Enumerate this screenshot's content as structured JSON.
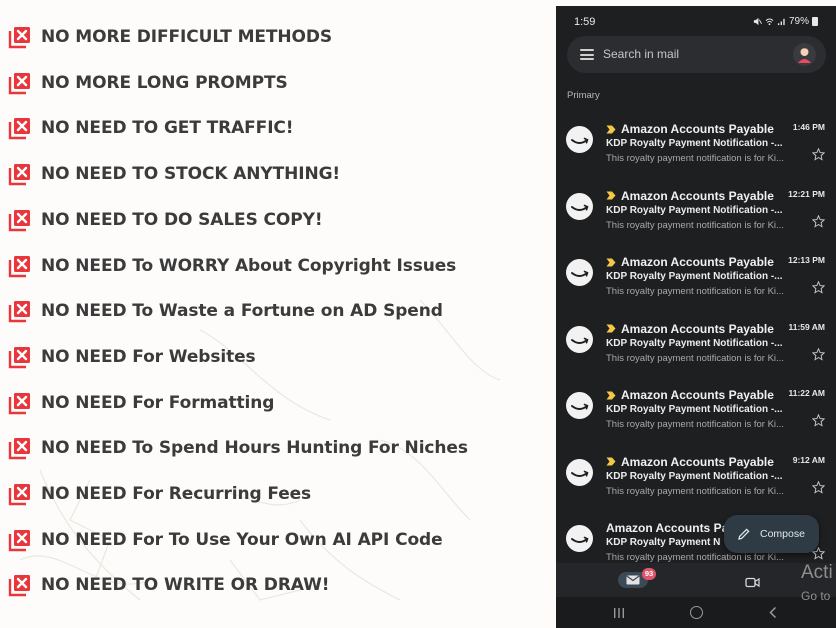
{
  "features": [
    "NO MORE DIFFICULT METHODS",
    "NO MORE LONG PROMPTS",
    "NO NEED TO GET TRAFFIC!",
    "NO NEED TO STOCK ANYTHING!",
    "NO NEED TO DO SALES COPY!",
    "NO NEED To WORRY About Copyright Issues",
    "NO NEED To Waste a Fortune on AD Spend",
    "NO NEED For Websites",
    "NO NEED For Formatting",
    "NO NEED To Spend Hours Hunting For Niches",
    "NO NEED For Recurring Fees",
    "NO NEED For To Use Your Own AI API Code",
    "NO NEED TO WRITE OR DRAW!"
  ],
  "feature_icon": "x-box-icon",
  "colors": {
    "icon_red": "#e8363b",
    "feature_text": "#3b3b3b",
    "phone_bg": "#1e1f21",
    "search_bg": "#2b2d31",
    "badge": "#e0556a",
    "compose_bg": "#2f3b44"
  },
  "phone": {
    "status": {
      "time": "1:59",
      "battery": "79%"
    },
    "search": {
      "placeholder": "Search in mail"
    },
    "section_label": "Primary",
    "emails": [
      {
        "sender": "Amazon Accounts Payable",
        "time": "1:46 PM",
        "subject": "KDP Royalty Payment Notification -...",
        "snippet": "This royalty payment notification is for Ki...",
        "important": true
      },
      {
        "sender": "Amazon Accounts Payable",
        "time": "12:21 PM",
        "subject": "KDP Royalty Payment Notification -...",
        "snippet": "This royalty payment notification is for Ki...",
        "important": true
      },
      {
        "sender": "Amazon Accounts Payable",
        "time": "12:13 PM",
        "subject": "KDP Royalty Payment Notification -...",
        "snippet": "This royalty payment notification is for Ki...",
        "important": true
      },
      {
        "sender": "Amazon Accounts Payable",
        "time": "11:59 AM",
        "subject": "KDP Royalty Payment Notification -...",
        "snippet": "This royalty payment notification is for Ki...",
        "important": true
      },
      {
        "sender": "Amazon Accounts Payable",
        "time": "11:22 AM",
        "subject": "KDP Royalty Payment Notification -...",
        "snippet": "This royalty payment notification is for Ki...",
        "important": true
      },
      {
        "sender": "Amazon Accounts Payable",
        "time": "9:12 AM",
        "subject": "KDP Royalty Payment Notification -...",
        "snippet": "This royalty payment notification is for Ki...",
        "important": true
      },
      {
        "sender": "Amazon Accounts Pa",
        "time": "",
        "subject": "KDP Royalty Payment N",
        "snippet": "This royalty payment notification is for Ki...",
        "important": false
      }
    ],
    "compose_label": "Compose",
    "mail_badge": "93"
  },
  "activation": {
    "title": "Acti",
    "subtitle": "Go to"
  }
}
